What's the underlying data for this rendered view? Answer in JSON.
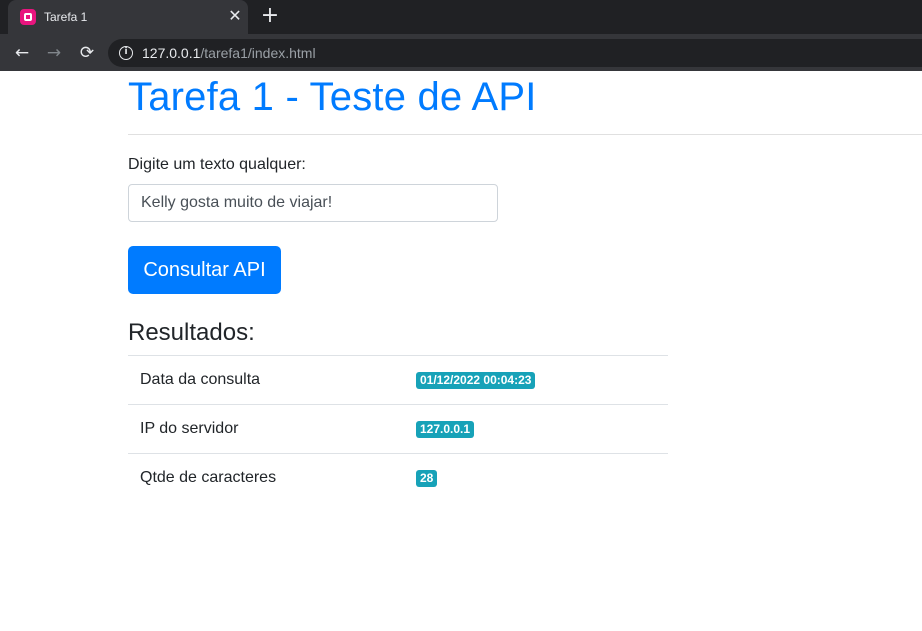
{
  "browser": {
    "tab_title": "Tarefa 1",
    "close_glyph": "✕",
    "newtab_glyph": "+",
    "back_glyph": "←",
    "forward_glyph": "→",
    "reload_glyph": "⟳",
    "info_glyph": "i",
    "url_host": "127.0.0.1",
    "url_path": "/tarefa1/index.html"
  },
  "page": {
    "title": "Tarefa 1 - Teste de API",
    "input_label": "Digite um texto qualquer:",
    "input_value": "Kelly gosta muito de viajar!",
    "button_label": "Consultar API",
    "results_heading": "Resultados:",
    "results": [
      {
        "label": "Data da consulta",
        "value": "01/12/2022 00:04:23"
      },
      {
        "label": "IP do servidor",
        "value": "127.0.0.1"
      },
      {
        "label": "Qtde de caracteres",
        "value": "28"
      }
    ]
  },
  "colors": {
    "primary": "#007bff",
    "badge": "#17a2b8",
    "favicon": "#e8157e"
  },
  "icons": {
    "favicon": "app-favicon-icon",
    "close": "close-icon",
    "newtab": "plus-icon",
    "back": "back-arrow-icon",
    "forward": "forward-arrow-icon",
    "reload": "reload-icon",
    "info": "info-icon"
  }
}
